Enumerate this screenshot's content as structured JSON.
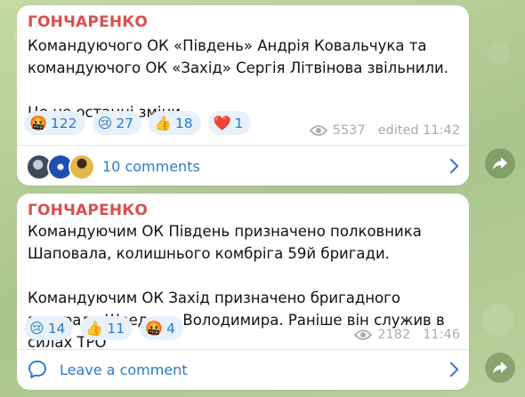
{
  "posts": [
    {
      "author": "ГОНЧАРЕНКО",
      "paragraphs": [
        "Командуючого ОК «Південь» Андрія Ковальчука та командуючого ОК «Захід» Сергія Літвінова звільнили.",
        "Це не останні зміни."
      ],
      "reactions": [
        {
          "emoji": "🤬",
          "count": "122"
        },
        {
          "emoji": "😢",
          "count": "27"
        },
        {
          "emoji": "👍",
          "count": "18"
        },
        {
          "emoji": "❤️",
          "count": "1"
        }
      ],
      "views": "5537",
      "time": "edited 11:42",
      "comments_label": "10 comments"
    },
    {
      "author": "ГОНЧАРЕНКО",
      "paragraphs": [
        "Командуючим ОК Південь призначено полковника Шаповала, колишнього комбріга 59й бригади.",
        "Командуючим ОК Захід призначено бригадного генерала Шведюка Володимира. Раніше він служив в силах ТРО"
      ],
      "reactions": [
        {
          "emoji": "😢",
          "count": "14"
        },
        {
          "emoji": "👍",
          "count": "11"
        },
        {
          "emoji": "🤬",
          "count": "4"
        }
      ],
      "views": "2182",
      "time": "11:46",
      "comments_label": "Leave a comment"
    }
  ],
  "icons": {
    "views": "eye-icon",
    "share": "share-arrow-icon",
    "chevron": "chevron-right-icon",
    "comment": "speech-bubble-icon"
  },
  "colors": {
    "author": "#d8504f",
    "accent": "#2d7bc9",
    "chip_bg": "#e8f1fa",
    "meta": "#a3acb3"
  }
}
